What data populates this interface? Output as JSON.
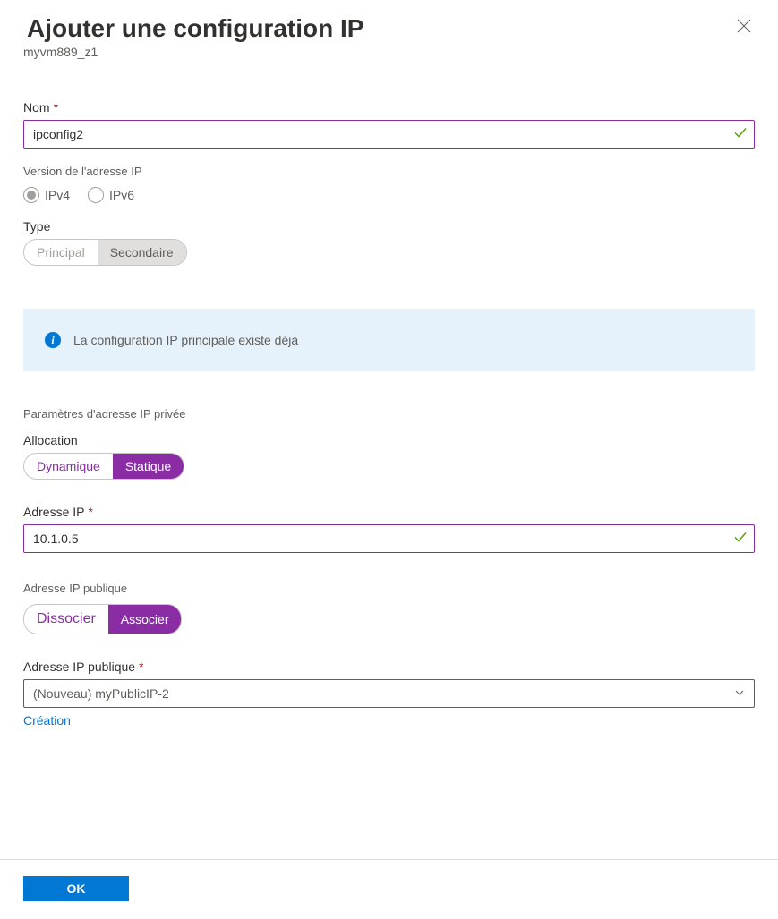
{
  "header": {
    "title": "Ajouter une configuration IP",
    "subtitle": "myvm889_z1"
  },
  "nameField": {
    "label": "Nom",
    "value": "ipconfig2"
  },
  "ipVersion": {
    "label": "Version de l'adresse IP",
    "options": {
      "ipv4": "IPv4",
      "ipv6": "IPv6"
    }
  },
  "type": {
    "label": "Type",
    "options": {
      "primary": "Principal",
      "secondary": "Secondaire"
    }
  },
  "info": {
    "text": "La configuration IP principale existe déjà"
  },
  "privateSection": {
    "header": "Paramètres d'adresse IP privée"
  },
  "allocation": {
    "label": "Allocation",
    "options": {
      "dynamic": "Dynamique",
      "static": "Statique"
    }
  },
  "ipAddress": {
    "label": "Adresse IP",
    "value": "10.1.0.5"
  },
  "publicIp": {
    "label": "Adresse IP publique",
    "options": {
      "dissociate": "Dissocier",
      "associate": "Associer"
    }
  },
  "publicIpSelect": {
    "label": "Adresse IP publique",
    "value": "(Nouveau) myPublicIP-2",
    "createLink": "Création"
  },
  "footer": {
    "ok": "OK"
  }
}
